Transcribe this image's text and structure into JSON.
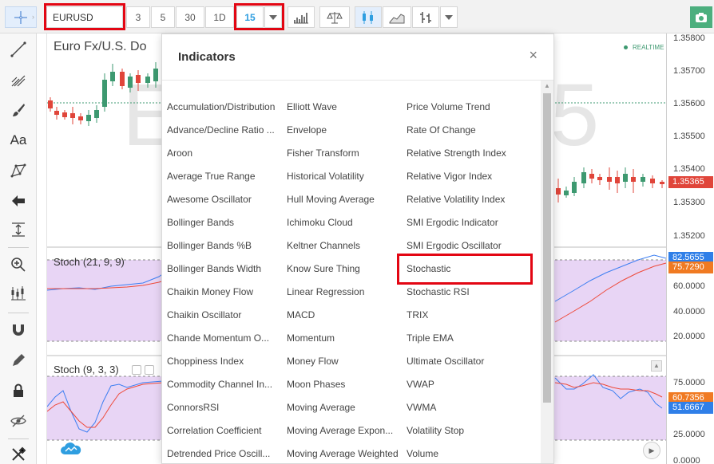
{
  "toolbar": {
    "symbol": "EURUSD",
    "intervals": [
      "3",
      "5",
      "30",
      "1D"
    ],
    "active_interval": "15",
    "dropdown_icon": "chevron-down-icon",
    "colors": {
      "active": "#2f9ee0",
      "highlight": "#e30613",
      "camera": "#4caf7e"
    }
  },
  "chart": {
    "symbol_title": "Euro Fx/U.S. Do",
    "realtime_label": "REALTIME",
    "watermark": "E 5",
    "colors": {
      "up_candle": "#3d9970",
      "down_candle": "#e0453a",
      "pane_fill": "#e8d5f5",
      "k_line": "#3d7ff2",
      "d_line": "#ee4a3a"
    }
  },
  "price_axis": {
    "labels": [
      "1.35800",
      "1.35700",
      "1.35600",
      "1.35500",
      "1.35400",
      "1.35300",
      "1.35200"
    ],
    "current_price": "1.35365",
    "stoch1_labels": [
      "60.0000",
      "40.0000",
      "20.0000"
    ],
    "stoch1_tags": [
      "82.5655",
      "75.7290"
    ],
    "stoch2_labels": [
      "75.0000",
      "25.0000",
      "0.0000"
    ],
    "stoch2_tags": [
      "60.7356",
      "51.6667"
    ],
    "tag_colors": {
      "price": "#e0453a",
      "k": "#2f7fe8",
      "d": "#f07a22"
    }
  },
  "panes": {
    "stoch1_title": "Stoch (21, 9, 9)",
    "stoch2_title": "Stoch (9, 3, 3)"
  },
  "dialog": {
    "title": "Indicators",
    "close": "×",
    "columns": [
      [
        "Accumulation/Distribution",
        "Advance/Decline Ratio ...",
        "Aroon",
        "Average True Range",
        "Awesome Oscillator",
        "Bollinger Bands",
        "Bollinger Bands %B",
        "Bollinger Bands Width",
        "Chaikin Money Flow",
        "Chaikin Oscillator",
        "Chande Momentum O...",
        "Choppiness Index",
        "Commodity Channel In...",
        "ConnorsRSI",
        "Correlation Coefficient",
        "Detrended Price Oscill..."
      ],
      [
        "Elliott Wave",
        "Envelope",
        "Fisher Transform",
        "Historical Volatility",
        "Hull Moving Average",
        "Ichimoku Cloud",
        "Keltner Channels",
        "Know Sure Thing",
        "Linear Regression",
        "MACD",
        "Momentum",
        "Money Flow",
        "Moon Phases",
        "Moving Average",
        "Moving Average Expon...",
        "Moving Average Weighted"
      ],
      [
        "Price Volume Trend",
        "Rate Of Change",
        "Relative Strength Index",
        "Relative Vigor Index",
        "Relative Volatility Index",
        "SMI Ergodic Indicator",
        "SMI Ergodic Oscillator",
        "Stochastic",
        "Stochastic RSI",
        "TRIX",
        "Triple EMA",
        "Ultimate Oscillator",
        "VWAP",
        "VWMA",
        "Volatility Stop",
        "Volume"
      ]
    ]
  },
  "left_tools": [
    "crosshair-icon",
    "trend-line-icon",
    "fork-icon",
    "brush-icon",
    "text-tool-icon",
    "pattern-icon",
    "arrow-left-icon",
    "measure-icon",
    "zoom-in-icon",
    "candles-icon",
    "magnet-icon",
    "pencil-icon",
    "lock-icon",
    "eye-hidden-icon",
    "tools-icon"
  ],
  "left_text_tool": "Aa"
}
